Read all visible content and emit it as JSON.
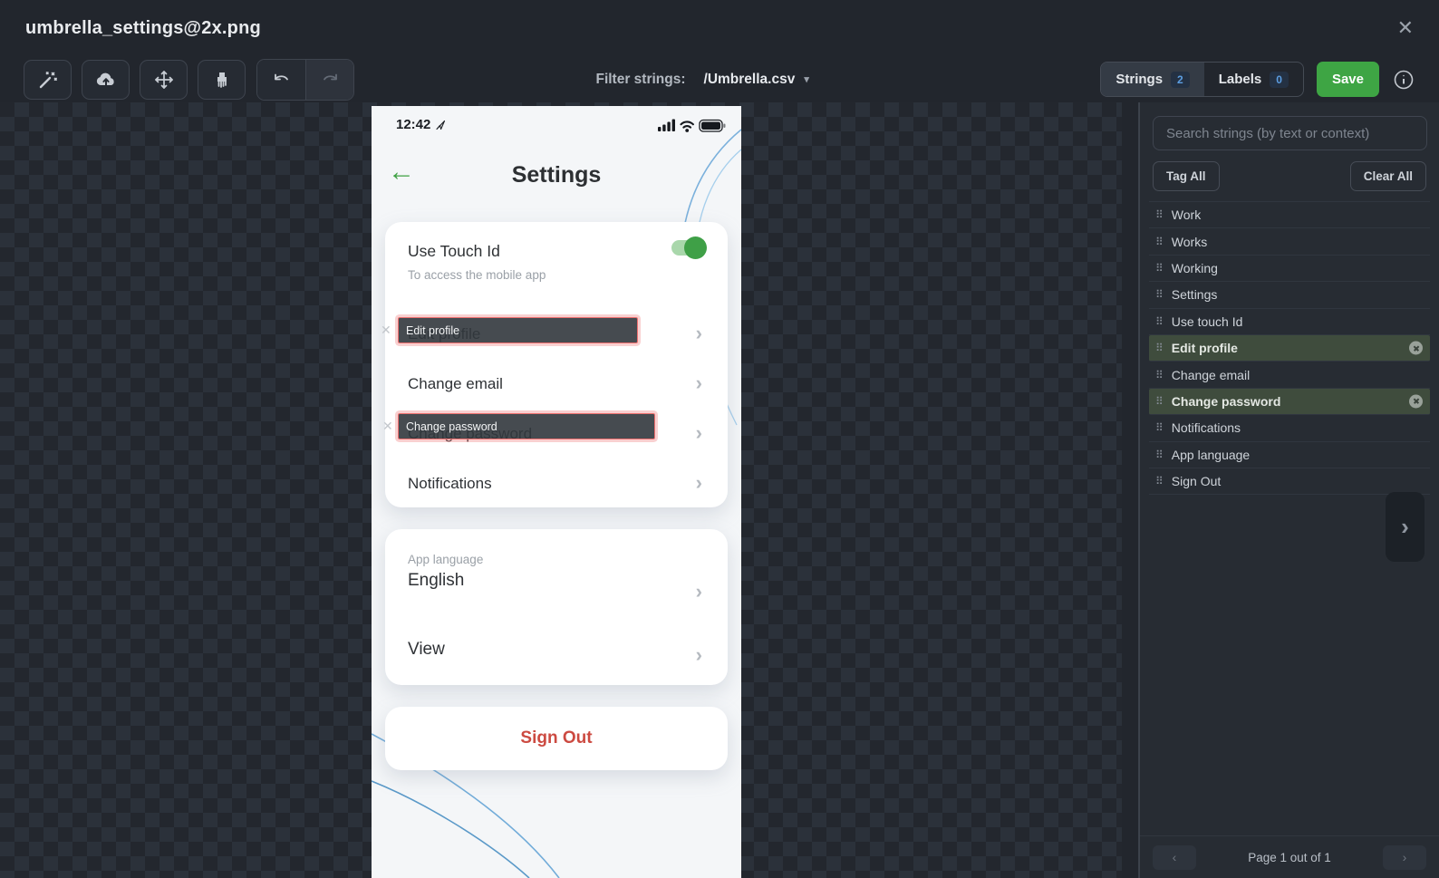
{
  "header": {
    "title": "umbrella_settings@2x.png"
  },
  "toolbar": {
    "filter_label": "Filter strings:",
    "filter_value": "/Umbrella.csv",
    "tabs": [
      {
        "label": "Strings",
        "count": "2"
      },
      {
        "label": "Labels",
        "count": "0"
      }
    ],
    "save_label": "Save"
  },
  "phone": {
    "status_time": "12:42",
    "title": "Settings",
    "card_security": {
      "toggle_title": "Use Touch Id",
      "toggle_subtitle": "To access the mobile app",
      "toggle_on": true,
      "rows": [
        "Edit profile",
        "Change email",
        "Change password",
        "Notifications"
      ]
    },
    "tags": [
      {
        "text": "Edit profile"
      },
      {
        "text": "Change password"
      }
    ],
    "card_preferences": {
      "label": "App language",
      "value": "English",
      "row": "View"
    },
    "signout_label": "Sign Out"
  },
  "sidebar": {
    "search_placeholder": "Search strings (by text or context)",
    "tag_all_label": "Tag All",
    "clear_all_label": "Clear All",
    "strings": [
      {
        "label": "Work",
        "tagged": false
      },
      {
        "label": "Works",
        "tagged": false
      },
      {
        "label": "Working",
        "tagged": false
      },
      {
        "label": "Settings",
        "tagged": false
      },
      {
        "label": "Use touch Id",
        "tagged": false
      },
      {
        "label": "Edit profile",
        "tagged": true
      },
      {
        "label": "Change email",
        "tagged": false
      },
      {
        "label": "Change password",
        "tagged": true
      },
      {
        "label": "Notifications",
        "tagged": false
      },
      {
        "label": "App language",
        "tagged": false
      },
      {
        "label": "Sign Out",
        "tagged": false
      }
    ],
    "pagination_label": "Page 1 out of 1"
  },
  "icons": {
    "close": "✕",
    "caret": "▾",
    "back_arrow": "←",
    "chevron": "›",
    "drag_handle": "⠿",
    "page_prev": "‹",
    "page_next": "›",
    "panel_collapse": "›",
    "tag_remove": "✕"
  },
  "colors": {
    "accent_green": "#3ea544",
    "toggle_green": "#3fa047",
    "tag_border_red": "#ee7070",
    "signout_red": "#cc4a41",
    "badge_blue": "#5c9ee2",
    "selected_row_green": "#3f4c3d"
  }
}
